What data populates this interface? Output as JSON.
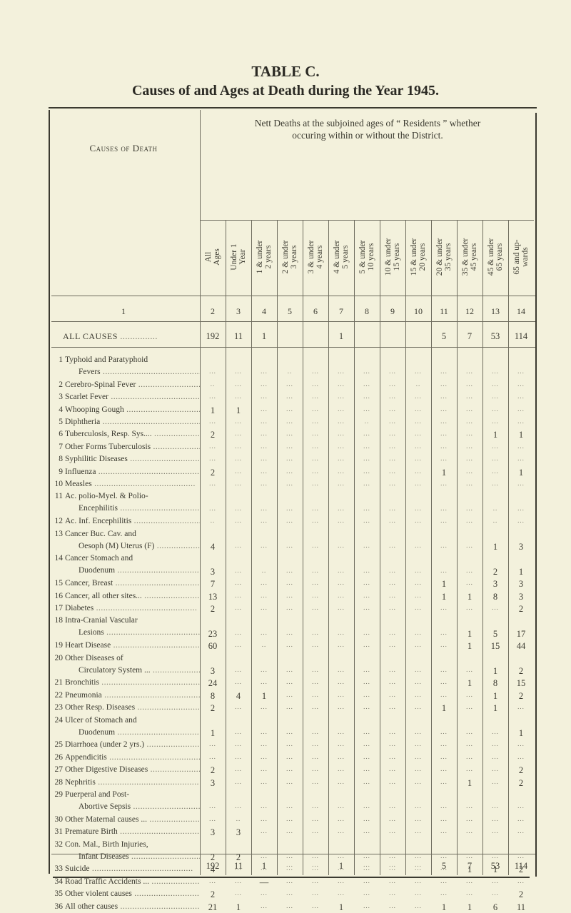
{
  "title": "TABLE C.",
  "subtitle": "Causes of and Ages at Death during the Year 1945.",
  "table": {
    "causes_header": "Causes of Death",
    "group_header_line1": "Nett Deaths at the subjoined ages of “ Residents ” whether",
    "group_header_line2": "occuring within or without the District.",
    "columns": [
      "All\nAges",
      "Under 1\nYear",
      "1 & under\n2 years",
      "2 & under\n3 years",
      "3 & under\n4 years",
      "4 & under\n5 years",
      "5 & under\n10 years",
      "10 & under\n15 years",
      "15 & under\n20 years",
      "20 & under\n35 years",
      "35 & under\n45 years",
      "45 & under\n65 years",
      "65 and up-\nwards"
    ],
    "column_numbers": [
      "1",
      "2",
      "3",
      "4",
      "5",
      "6",
      "7",
      "8",
      "9",
      "10",
      "11",
      "12",
      "13",
      "14"
    ],
    "all_causes": {
      "label": "ALL CAUSES",
      "values": [
        "192",
        "11",
        "1",
        "",
        "",
        "1",
        "",
        "",
        "",
        "5",
        "7",
        "53",
        "114"
      ]
    },
    "rows": [
      {
        "num": "1",
        "label": [
          "Typhoid and Paratyphoid",
          "Fevers"
        ],
        "values": [
          "...",
          "...",
          "...",
          "..",
          "...",
          "...",
          "...",
          "...",
          "...",
          "...",
          "...",
          "...",
          "..."
        ]
      },
      {
        "num": "2",
        "label": [
          "Cerebro-Spinal Fever"
        ],
        "values": [
          "..",
          "...",
          "...",
          "...",
          "...",
          "...",
          "...",
          "...",
          "..",
          "...",
          "...",
          "...",
          "..."
        ]
      },
      {
        "num": "3",
        "label": [
          "Scarlet Fever"
        ],
        "values": [
          "...",
          "...",
          "...",
          "...",
          "...",
          "...",
          "...",
          "...",
          "...",
          "...",
          "...",
          "...",
          "..."
        ]
      },
      {
        "num": "4",
        "label": [
          "Whooping Gough"
        ],
        "values": [
          "1",
          "1",
          "...",
          "...",
          "...",
          "...",
          "...",
          "...",
          "...",
          "...",
          "...",
          "...",
          "..."
        ]
      },
      {
        "num": "5",
        "label": [
          "Diphtheria"
        ],
        "values": [
          "...",
          "...",
          "...",
          "...",
          "...",
          "...",
          "..",
          "...",
          "...",
          "...",
          "...",
          "...",
          "..."
        ]
      },
      {
        "num": "6",
        "label": [
          "Tuberculosis, Resp. Sys...."
        ],
        "values": [
          "2",
          "...",
          "...",
          "...",
          "...",
          "...",
          "...",
          "...",
          "...",
          "...",
          "...",
          "1",
          "1"
        ]
      },
      {
        "num": "7",
        "label": [
          "Other Forms Tuberculosis"
        ],
        "values": [
          "...",
          "...",
          "...",
          "...",
          "...",
          "...",
          "...",
          "...",
          "...",
          "...",
          "...",
          "...",
          "..."
        ]
      },
      {
        "num": "8",
        "label": [
          "Syphilitic Diseases"
        ],
        "values": [
          "...",
          "...",
          "...",
          "...",
          "...",
          "...",
          "...",
          "...",
          "...",
          "...",
          "...",
          "...",
          "..."
        ]
      },
      {
        "num": "9",
        "label": [
          "Influenza"
        ],
        "values": [
          "2",
          "...",
          "...",
          "...",
          "...",
          "...",
          "...",
          "...",
          "...",
          "1",
          "...",
          "...",
          "1"
        ]
      },
      {
        "num": "10",
        "label": [
          "Measles"
        ],
        "values": [
          "...",
          "...",
          "...",
          "...",
          "...",
          "...",
          "...",
          "...",
          "...",
          "...",
          "...",
          "...",
          "..."
        ]
      },
      {
        "num": "11",
        "label": [
          "Ac. polio-Myel. & Polio-",
          "Encephilitis"
        ],
        "values": [
          "...",
          "...",
          "...",
          "...",
          "...",
          "...",
          "...",
          "...",
          "...",
          "...",
          "...",
          "..",
          "..."
        ]
      },
      {
        "num": "12",
        "label": [
          "Ac. Inf. Encephilitis"
        ],
        "values": [
          "..",
          "...",
          "...",
          "...",
          "...",
          "...",
          "...",
          "...",
          "...",
          "...",
          "...",
          "..",
          "..."
        ]
      },
      {
        "num": "13",
        "label": [
          "Cancer Buc. Cav. and",
          "Oesoph (M) Uterus (F)"
        ],
        "values": [
          "4",
          "...",
          "...",
          "...",
          "...",
          "...",
          "...",
          "...",
          "...",
          "...",
          "...",
          "1",
          "3"
        ]
      },
      {
        "num": "14",
        "label": [
          "Cancer Stomach and",
          "Duodenum"
        ],
        "values": [
          "3",
          "...",
          "..",
          "...",
          "...",
          "...",
          "...",
          "...",
          "...",
          "...",
          "...",
          "2",
          "1"
        ]
      },
      {
        "num": "15",
        "label": [
          "Cancer, Breast"
        ],
        "values": [
          "7",
          "...",
          "...",
          "...",
          "...",
          "...",
          "...",
          "...",
          "...",
          "1",
          "...",
          "3",
          "3"
        ]
      },
      {
        "num": "16",
        "label": [
          "Cancer, all other sites..."
        ],
        "values": [
          "13",
          "...",
          "...",
          "...",
          "...",
          "...",
          "...",
          "...",
          "...",
          "1",
          "1",
          "8",
          "3"
        ]
      },
      {
        "num": "17",
        "label": [
          "Diabetes"
        ],
        "values": [
          "2",
          "...",
          "...",
          "...",
          "...",
          "...",
          "...",
          "...",
          "...",
          "...",
          "...",
          "...",
          "2"
        ]
      },
      {
        "num": "18",
        "label": [
          "Intra-Cranial Vascular",
          "Lesions"
        ],
        "values": [
          "23",
          "...",
          "...",
          "...",
          "...",
          "...",
          "...",
          "...",
          "...",
          "...",
          "1",
          "5",
          "17"
        ]
      },
      {
        "num": "19",
        "label": [
          "Heart Disease"
        ],
        "values": [
          "60",
          "...",
          "..",
          "...",
          "...",
          "...",
          "...",
          "...",
          "...",
          "...",
          "1",
          "15",
          "44"
        ]
      },
      {
        "num": "20",
        "label": [
          "Other Diseases of",
          "Circulatory System ..."
        ],
        "values": [
          "3",
          "...",
          "...",
          "...",
          "...",
          "...",
          "...",
          "...",
          "...",
          "...",
          "...",
          "1",
          "2"
        ]
      },
      {
        "num": "21",
        "label": [
          "Bronchitis"
        ],
        "values": [
          "24",
          "...",
          "...",
          "...",
          "...",
          "...",
          "...",
          "...",
          "...",
          "...",
          "1",
          "8",
          "15"
        ]
      },
      {
        "num": "22",
        "label": [
          "Pneumonia"
        ],
        "values": [
          "8",
          "4",
          "1",
          "...",
          "...",
          "...",
          "...",
          "...",
          "...",
          "...",
          "...",
          "1",
          "2"
        ]
      },
      {
        "num": "23",
        "label": [
          "Other Resp. Diseases"
        ],
        "values": [
          "2",
          "...",
          "...",
          "...",
          "...",
          "...",
          "...",
          "...",
          "...",
          "1",
          "...",
          "1",
          "..."
        ]
      },
      {
        "num": "24",
        "label": [
          "Ulcer of Stomach and",
          "Duodenum"
        ],
        "values": [
          "1",
          "...",
          "...",
          "...",
          "...",
          "...",
          "...",
          "...",
          "...",
          "...",
          "...",
          "...",
          "1"
        ]
      },
      {
        "num": "25",
        "label": [
          "Diarrhoea (under 2 yrs.)"
        ],
        "values": [
          "...",
          "...",
          "...",
          "...",
          "...",
          "...",
          "...",
          "...",
          "...",
          "...",
          "...",
          "...",
          "..."
        ]
      },
      {
        "num": "26",
        "label": [
          "Appendicitis"
        ],
        "values": [
          "...",
          "...",
          "...",
          "...",
          "...",
          "...",
          "...",
          "...",
          "...",
          "...",
          "...",
          "...",
          "..."
        ]
      },
      {
        "num": "27",
        "label": [
          "Other Digestive Diseases"
        ],
        "values": [
          "2",
          "...",
          "...",
          "...",
          "...",
          "...",
          "...",
          "...",
          "...",
          "...",
          "...",
          "...",
          "2"
        ]
      },
      {
        "num": "28",
        "label": [
          "Nephritis"
        ],
        "values": [
          "3",
          "...",
          "...",
          "...",
          "...",
          "...",
          "...",
          "...",
          "...",
          "...",
          "1",
          "...",
          "2"
        ]
      },
      {
        "num": "29",
        "label": [
          "Puerperal and Post-",
          "Abortive Sepsis"
        ],
        "values": [
          "...",
          "...",
          "...",
          "...",
          "...",
          "...",
          "...",
          "...",
          "...",
          "...",
          "...",
          "...",
          "..."
        ]
      },
      {
        "num": "30",
        "label": [
          "Other Maternal causes ..."
        ],
        "values": [
          "...",
          "..",
          "...",
          "...",
          "...",
          "...",
          "...",
          "...",
          "...",
          "...",
          "...",
          "...",
          "..."
        ]
      },
      {
        "num": "31",
        "label": [
          "Premature Birth"
        ],
        "values": [
          "3",
          "3",
          "...",
          "...",
          "...",
          "...",
          "...",
          "...",
          "...",
          "...",
          "...",
          "...",
          "..."
        ]
      },
      {
        "num": "32",
        "label": [
          "Con. Mal., Birth Injuries,",
          "Infant Diseases"
        ],
        "values": [
          "2",
          "2",
          "...",
          "...",
          "...",
          "...",
          "...",
          "...",
          "...",
          "...",
          "...",
          "...",
          "..."
        ]
      },
      {
        "num": "33",
        "label": [
          "Suicide"
        ],
        "values": [
          "4",
          "...",
          "...",
          "...",
          "...",
          "...",
          "...",
          "...",
          "...",
          "...",
          "1",
          "1",
          "2"
        ]
      },
      {
        "num": "34",
        "label": [
          "Road Traffic Accidents ..."
        ],
        "values": [
          "...",
          "...",
          "—",
          "...",
          "...",
          "...",
          "...",
          "...",
          "...",
          "...",
          "...",
          "...",
          "..."
        ]
      },
      {
        "num": "35",
        "label": [
          "Other violent causes"
        ],
        "values": [
          "2",
          "...",
          "...",
          "...",
          "...",
          "...",
          "...",
          "...",
          "...",
          "...",
          "...",
          "...",
          "2"
        ]
      },
      {
        "num": "36",
        "label": [
          "All other causes"
        ],
        "values": [
          "21",
          "1",
          "...",
          "...",
          "...",
          "1",
          "...",
          "...",
          "...",
          "1",
          "1",
          "6",
          "11"
        ]
      }
    ],
    "totals": [
      "192",
      "11",
      "1",
      "...",
      "...",
      "1",
      "...",
      "...",
      "...",
      "5",
      "7",
      "53",
      "114"
    ]
  }
}
